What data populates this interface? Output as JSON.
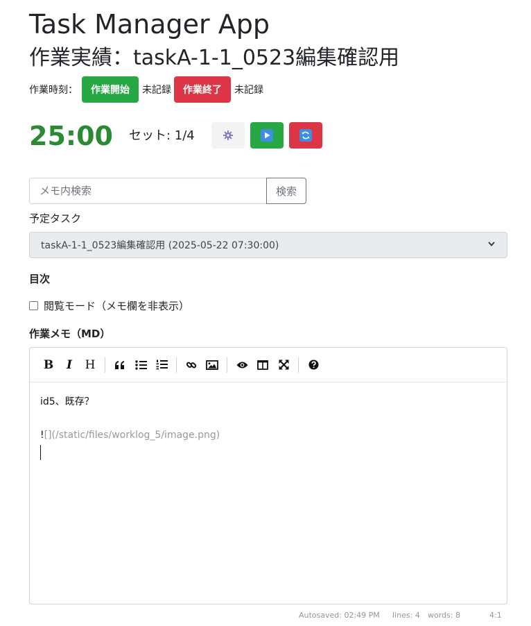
{
  "header": {
    "app_title": "Task Manager App",
    "page_title": "作業実績：taskA-1-1_0523編集確認用"
  },
  "work_time": {
    "label": "作業時刻：",
    "start_button": "作業開始",
    "start_value": "未記録",
    "end_button": "作業終了",
    "end_value": "未記録"
  },
  "pomodoro": {
    "timer": "25:00",
    "set_label": "セット: 1/4",
    "settings_icon": "gear-icon",
    "play_icon": "play-icon",
    "reset_icon": "reset-icon"
  },
  "search": {
    "placeholder": "メモ内検索",
    "button": "検索"
  },
  "planned_task": {
    "label": "予定タスク",
    "selected": "taskA-1-1_0523編集確認用 (2025-05-22 07:30:00)"
  },
  "toc": {
    "label": "目次"
  },
  "view_mode": {
    "label": "閲覧モード（メモ欄を非表示）",
    "checked": false
  },
  "memo": {
    "label": "作業メモ（MD）",
    "toolbar": {
      "bold": "B",
      "italic": "I",
      "heading": "H"
    },
    "content": {
      "line1": "id5、既存？",
      "line2_prefix": "!",
      "line2_rest": "[](/static/files/worklog_5/image.png)"
    },
    "status": {
      "autosaved": "Autosaved: 02:49 PM",
      "lines": "lines: 4",
      "words": "words: 8",
      "cursor": "4:1"
    }
  },
  "colors": {
    "green": "#28a745",
    "red": "#dc3545",
    "timer": "#2c8a35"
  }
}
